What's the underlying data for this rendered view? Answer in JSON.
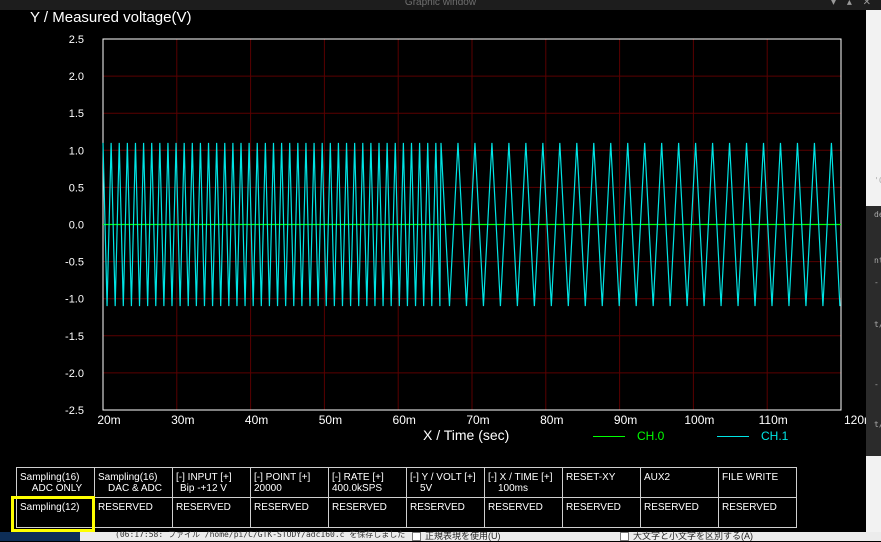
{
  "window": {
    "title": "Graphic window",
    "controls": "▾ ▴ ✕"
  },
  "chart_data": {
    "type": "line",
    "ylabel": "Y / Measured voltage(V)",
    "xlabel": "X / Time (sec)",
    "ylim": [
      -2.5,
      2.5
    ],
    "xlim": [
      0.02,
      0.12
    ],
    "y_ticks": [
      "2.5",
      "2.0",
      "1.5",
      "1.0",
      "0.5",
      "0.0",
      "-0.5",
      "-1.0",
      "-1.5",
      "-2.0",
      "-2.5"
    ],
    "x_ticks": [
      "20m",
      "30m",
      "40m",
      "50m",
      "60m",
      "70m",
      "80m",
      "90m",
      "100m",
      "110m",
      "120m"
    ],
    "grid": true,
    "legend_position": "bottom-right",
    "series": [
      {
        "name": "CH.0",
        "color": "#00ff00",
        "kind": "constant",
        "value": 0.0
      },
      {
        "name": "CH.1",
        "color": "#00e5e5",
        "kind": "triangle",
        "high": 1.1,
        "low": -1.1,
        "segments": [
          {
            "x_start": 0.02,
            "x_end": 0.0658,
            "period": 0.0011
          },
          {
            "x_start": 0.0658,
            "x_end": 0.12,
            "period": 0.0023
          }
        ]
      }
    ]
  },
  "buttons": {
    "row1": [
      {
        "l1": "Sampling(16)",
        "l2": "ADC ONLY",
        "align": "center"
      },
      {
        "l1": "Sampling(16)",
        "l2": "DAC & ADC",
        "align": "center"
      },
      {
        "l1": "[-]  INPUT  [+]",
        "l2": "Bip -+12 V",
        "align": "left"
      },
      {
        "l1": "[-]  POINT  [+]",
        "l2": "20000",
        "align": "none"
      },
      {
        "l1": "[-]   RATE   [+]",
        "l2": "400.0kSPS",
        "align": "none"
      },
      {
        "l1": "[-] Y / VOLT [+]",
        "l2": "5V",
        "align": "left"
      },
      {
        "l1": "[-] X / TIME [+]",
        "l2": "100ms",
        "align": "left"
      },
      {
        "l1": "RESET-XY",
        "l2": "",
        "align": "none"
      },
      {
        "l1": "AUX2",
        "l2": "",
        "align": "none"
      },
      {
        "l1": "FILE WRITE",
        "l2": "",
        "align": "none"
      }
    ],
    "row2": [
      "Sampling(12)",
      "RESERVED",
      "RESERVED",
      "RESERVED",
      "RESERVED",
      "RESERVED",
      "RESERVED",
      "RESERVED",
      "RESERVED",
      "RESERVED"
    ]
  },
  "background_app": {
    "log_line": "(06:17:58: ファイル /home/pi/C/GTK-STUDY/adc160.c を保存しました",
    "option_regex": "正規表現を使用(U)",
    "option_case": "大文字と小文字を区別する(A)",
    "edge_text": [
      "'C",
      "de",
      "nt",
      "-",
      "t/",
      "-",
      "t/"
    ]
  }
}
